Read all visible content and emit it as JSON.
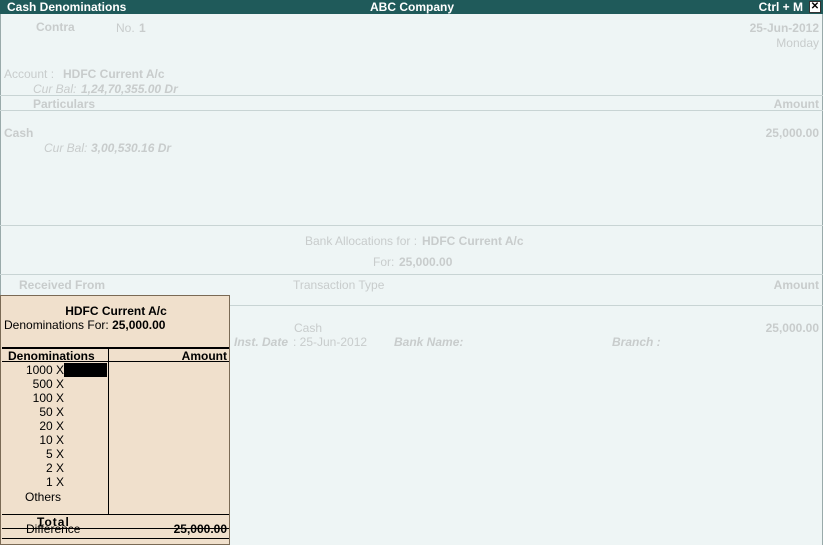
{
  "titlebar": {
    "left": "Cash Denominations",
    "center": "ABC Company",
    "right": "Ctrl + M",
    "close": "✕"
  },
  "voucher": {
    "type": "Contra",
    "no_label": "No.",
    "no": "1",
    "date": "25-Jun-2012",
    "day": "Monday",
    "account_label": "Account :",
    "account": "HDFC Current A/c",
    "cur_bal_label": "Cur Bal:",
    "account_cur_bal": "1,24,70,355.00 Dr",
    "col_particulars": "Particulars",
    "col_amount": "Amount",
    "entry_ledger": "Cash",
    "entry_amount": "25,000.00",
    "entry_cur_bal": "3,00,530.16 Dr"
  },
  "bank_alloc": {
    "title_label": "Bank Allocations for :",
    "title_value": "HDFC Current A/c",
    "for_label": "For:",
    "for_value": "25,000.00",
    "col_received_from": "Received From",
    "col_transaction_type": "Transaction Type",
    "col_amount": "Amount",
    "row_type": "Cash",
    "row_amount": "25,000.00",
    "inst_date_label": "Inst. Date",
    "inst_date": ": 25-Jun-2012",
    "bank_name_label": "Bank Name:",
    "branch_label": "Branch :"
  },
  "popup": {
    "title": "HDFC Current A/c",
    "for_label": "Denominations For:",
    "for_value": "25,000.00",
    "col_denominations": "Denominations",
    "col_amount": "Amount",
    "rows": [
      "1000 X",
      "500 X",
      "100 X",
      "50 X",
      "20 X",
      "10 X",
      "5 X",
      "2 X",
      "1 X"
    ],
    "others": "Others",
    "total_label": "Total",
    "difference_label": "Difference",
    "difference_value": "25,000.00"
  }
}
